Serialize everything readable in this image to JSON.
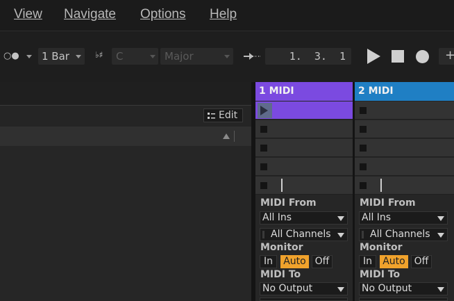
{
  "menu": {
    "items": [
      {
        "label": "View"
      },
      {
        "label": "Navigate"
      },
      {
        "label": "Options"
      },
      {
        "label": "Help"
      }
    ]
  },
  "toolbar": {
    "follow_glyph": "○●",
    "quantize": "1 Bar",
    "key_glyph": "♭♯",
    "key": "C",
    "scale": "Major",
    "arrangement_position": "1.  3.  1"
  },
  "browser": {
    "edit_label": "Edit"
  },
  "tracks": [
    {
      "name": "1 MIDI",
      "color": "#7b4ae0",
      "midi_from_label": "MIDI From",
      "midi_from": "All Ins",
      "channel": "All Channels",
      "monitor_label": "Monitor",
      "monitor": [
        "In",
        "Auto",
        "Off"
      ],
      "monitor_active": "Auto",
      "midi_to_label": "MIDI To",
      "midi_to": "No Output"
    },
    {
      "name": "2 MIDI",
      "color": "#1f7fc4",
      "midi_from_label": "MIDI From",
      "midi_from": "All Ins",
      "channel": "All Channels",
      "monitor_label": "Monitor",
      "monitor": [
        "In",
        "Auto",
        "Off"
      ],
      "monitor_active": "Auto",
      "midi_to_label": "MIDI To",
      "midi_to": "No Output"
    }
  ],
  "colors": {
    "monitor_active": "#f0a22c"
  }
}
